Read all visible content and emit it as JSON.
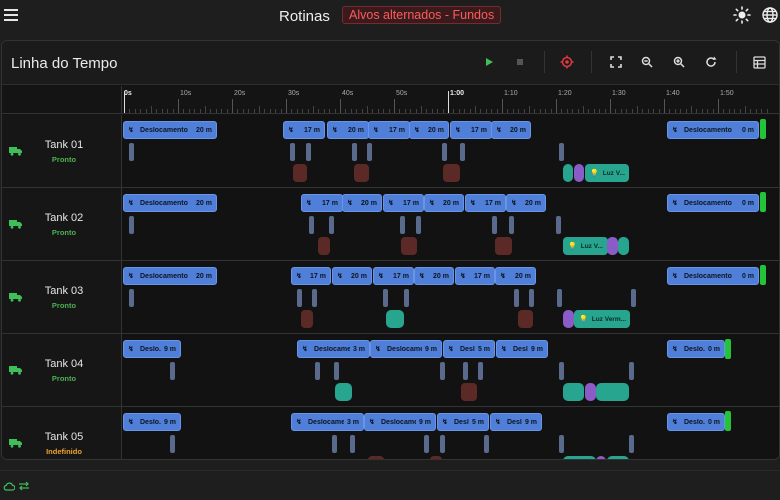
{
  "appbar": {
    "title": "Rotinas",
    "badge": "Alvos alternados - Fundos",
    "icons": [
      "menu-icon",
      "sun-icon",
      "globe-icon"
    ]
  },
  "card": {
    "title": "Linha do Tempo",
    "toolbar": [
      "play-icon",
      "stop-icon",
      "target-icon",
      "fullscreen-icon",
      "zoom-out-icon",
      "zoom-in-icon",
      "refresh-icon",
      "table-icon"
    ]
  },
  "ruler": {
    "ticks": [
      "0s",
      "10s",
      "20s",
      "30s",
      "40s",
      "50s",
      "1:00",
      "1:10",
      "1:20",
      "1:30",
      "1:40",
      "1:50"
    ]
  },
  "tanks": [
    {
      "name": "Tank 01",
      "status": "Pronto",
      "status_color": "#4caf50",
      "blocks": [
        {
          "label": "Deslocamento",
          "dur": "20 m"
        },
        {
          "label": "",
          "dur": "17 m"
        },
        {
          "label": "",
          "dur": "20 m"
        },
        {
          "label": "",
          "dur": "17 m"
        },
        {
          "label": "",
          "dur": "20 m"
        },
        {
          "label": "",
          "dur": "17 m"
        },
        {
          "label": "",
          "dur": "20 m"
        },
        {
          "label": "Deslocamento",
          "dur": "0 m"
        }
      ],
      "light": "Luz V..."
    },
    {
      "name": "Tank 02",
      "status": "Pronto",
      "status_color": "#4caf50",
      "blocks": [
        {
          "label": "Deslocamento",
          "dur": "20 m"
        },
        {
          "label": "",
          "dur": "17 m"
        },
        {
          "label": "",
          "dur": "20 m"
        },
        {
          "label": "",
          "dur": "17 m"
        },
        {
          "label": "",
          "dur": "20 m"
        },
        {
          "label": "",
          "dur": "17 m"
        },
        {
          "label": "",
          "dur": "20 m"
        },
        {
          "label": "Deslocamento",
          "dur": "0 m"
        }
      ],
      "light": "Luz V..."
    },
    {
      "name": "Tank 03",
      "status": "Pronto",
      "status_color": "#4caf50",
      "blocks": [
        {
          "label": "Deslocamento",
          "dur": "20 m"
        },
        {
          "label": "",
          "dur": "17 m"
        },
        {
          "label": "",
          "dur": "20 m"
        },
        {
          "label": "",
          "dur": "17 m"
        },
        {
          "label": "",
          "dur": "20 m"
        },
        {
          "label": "",
          "dur": "17 m"
        },
        {
          "label": "",
          "dur": "20 m"
        },
        {
          "label": "Deslocamento",
          "dur": "0 m"
        }
      ],
      "light": "Luz Verm..."
    },
    {
      "name": "Tank 04",
      "status": "Pronto",
      "status_color": "#4caf50",
      "blocks": [
        {
          "label": "Deslo...",
          "dur": "9 m"
        },
        {
          "label": "Deslocame...",
          "dur": "3 m"
        },
        {
          "label": "Deslocame...",
          "dur": "9 m"
        },
        {
          "label": "Desl...",
          "dur": "5 m"
        },
        {
          "label": "Desl...",
          "dur": "9 m"
        },
        {
          "label": "Deslo...",
          "dur": "0 m"
        }
      ]
    },
    {
      "name": "Tank 05",
      "status": "Indefinido",
      "status_color": "#f0a030",
      "blocks": [
        {
          "label": "Deslo...",
          "dur": "9 m"
        },
        {
          "label": "Deslocame...",
          "dur": "3 m"
        },
        {
          "label": "Deslocame...",
          "dur": "9 m"
        },
        {
          "label": "Desl...",
          "dur": "5 m"
        },
        {
          "label": "Desl...",
          "dur": "9 m"
        },
        {
          "label": "Deslo...",
          "dur": "0 m"
        }
      ]
    }
  ],
  "footer": {
    "icons": [
      "cloud-check-icon",
      "sync-icon"
    ]
  }
}
